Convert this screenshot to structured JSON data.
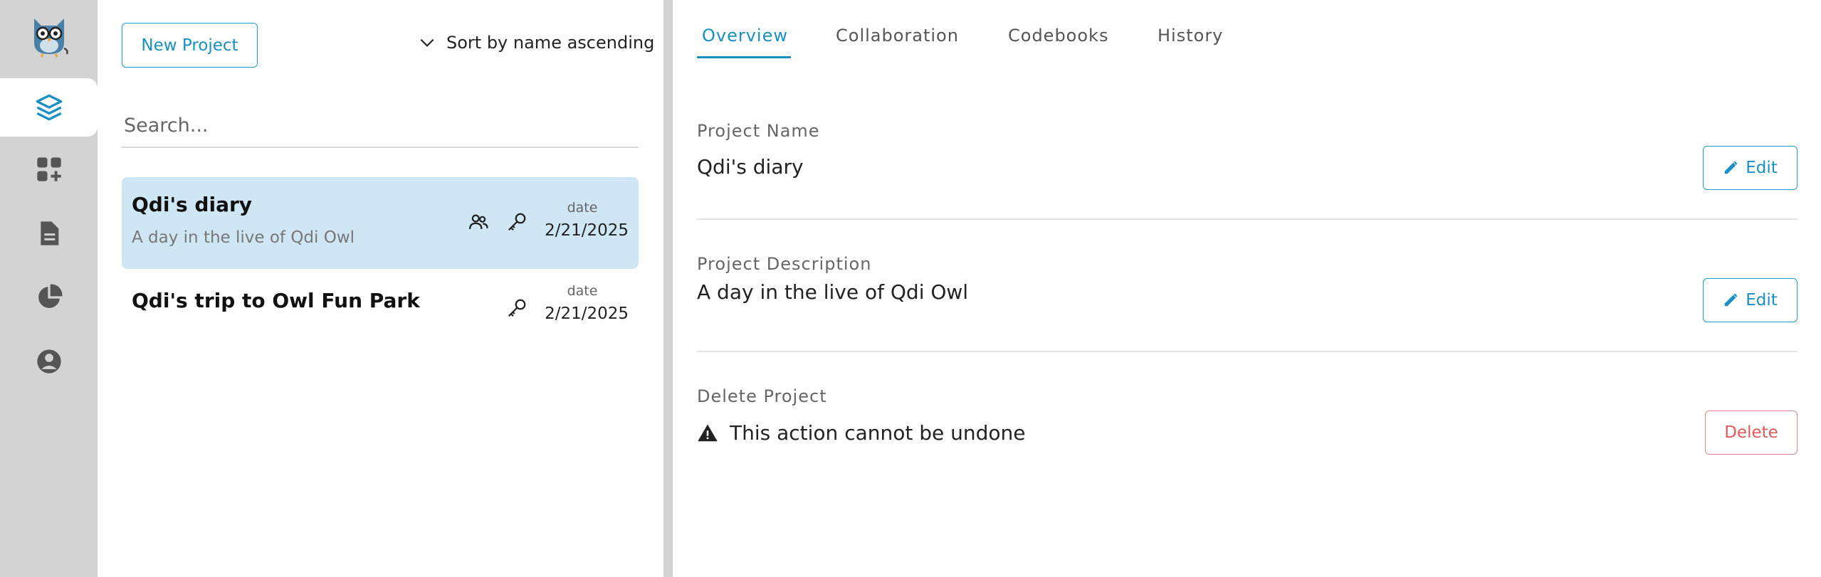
{
  "sidebar": {
    "items": [
      {
        "name": "projects",
        "icon": "layers-icon",
        "active": true
      },
      {
        "name": "add-widget",
        "icon": "widgets-add-icon",
        "active": false
      },
      {
        "name": "documents",
        "icon": "document-icon",
        "active": false
      },
      {
        "name": "analytics",
        "icon": "pie-chart-icon",
        "active": false
      },
      {
        "name": "account",
        "icon": "account-circle-icon",
        "active": false
      }
    ]
  },
  "projects_panel": {
    "new_project_label": "New Project",
    "sort_label": "Sort by name ascending",
    "search_placeholder": "Search...",
    "projects": [
      {
        "title": "Qdi's diary",
        "description": "A day in the live of Qdi Owl",
        "date_label": "date",
        "date": "2/21/2025",
        "selected": true,
        "icons": [
          "collaborators-icon",
          "key-icon"
        ]
      },
      {
        "title": "Qdi's trip to Owl Fun Park",
        "description": "",
        "date_label": "date",
        "date": "2/21/2025",
        "selected": false,
        "icons": [
          "key-icon"
        ]
      }
    ]
  },
  "detail": {
    "tabs": [
      {
        "label": "Overview",
        "active": true
      },
      {
        "label": "Collaboration",
        "active": false
      },
      {
        "label": "Codebooks",
        "active": false
      },
      {
        "label": "History",
        "active": false
      }
    ],
    "project_name_label": "Project Name",
    "project_name_value": "Qdi's diary",
    "project_description_label": "Project Description",
    "project_description_value": "A day in the live of Qdi Owl",
    "delete_label": "Delete Project",
    "delete_warning": "This action cannot be undone",
    "edit_label": "Edit",
    "delete_button_label": "Delete"
  },
  "colors": {
    "accent": "#1a8fc4",
    "selected_bg": "#cfe7f5",
    "sidebar_bg": "#d3d3d3",
    "danger": "#e05a5a"
  }
}
